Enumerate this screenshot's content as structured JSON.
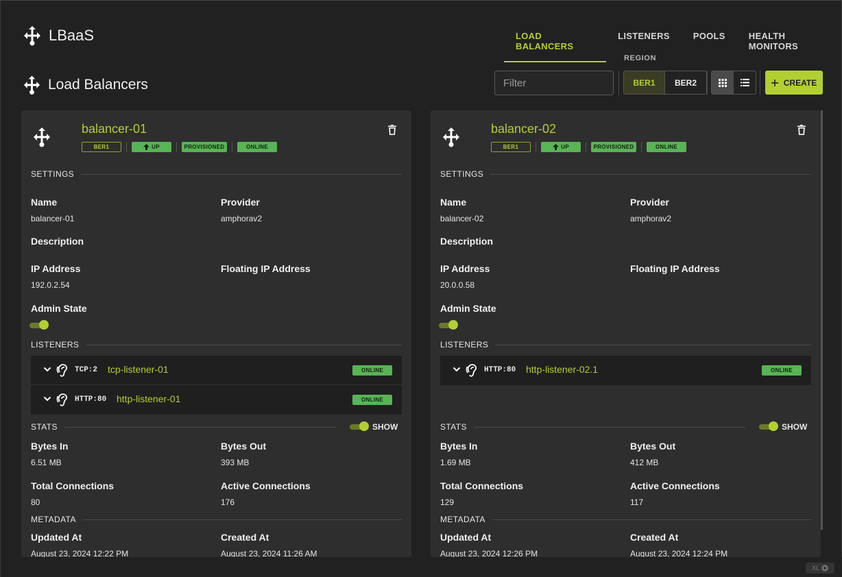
{
  "app": {
    "title": "LBaaS"
  },
  "nav": {
    "tabs": [
      {
        "label": "LOAD BALANCERS",
        "active": true
      },
      {
        "label": "LISTENERS",
        "active": false
      },
      {
        "label": "POOLS",
        "active": false
      },
      {
        "label": "HEALTH MONITORS",
        "active": false
      }
    ]
  },
  "page": {
    "title": "Load Balancers"
  },
  "toolbar": {
    "filter_placeholder": "Filter",
    "region_label": "REGION",
    "regions": [
      "BER1",
      "BER2"
    ],
    "selected_region": "BER1",
    "view_modes": [
      "grid",
      "list"
    ],
    "selected_view": "grid",
    "create_label": "CREATE"
  },
  "section_titles": {
    "settings": "SETTINGS",
    "listeners": "LISTENERS",
    "stats": "STATS",
    "metadata": "METADATA"
  },
  "field_labels": {
    "name": "Name",
    "provider": "Provider",
    "description": "Description",
    "ip_address": "IP Address",
    "floating_ip": "Floating IP Address",
    "admin_state": "Admin State",
    "bytes_in": "Bytes In",
    "bytes_out": "Bytes Out",
    "total_connections": "Total Connections",
    "active_connections": "Active Connections",
    "updated_at": "Updated At",
    "created_at": "Created At",
    "show": "SHOW"
  },
  "balancers": [
    {
      "name": "balancer-01",
      "badges": {
        "region": "BER1",
        "status": "UP",
        "provisioning": "PROVISIONED",
        "operating": "ONLINE"
      },
      "settings": {
        "name": "balancer-01",
        "provider": "amphorav2",
        "description": "",
        "ip_address": "192.0.2.54",
        "floating_ip": "",
        "admin_state": true
      },
      "listeners": [
        {
          "protocol": "TCP:2",
          "name": "tcp-listener-01",
          "status": "ONLINE"
        },
        {
          "protocol": "HTTP:80",
          "name": "http-listener-01",
          "status": "ONLINE"
        }
      ],
      "stats": {
        "show": true,
        "bytes_in": "6.51 MB",
        "bytes_out": "393 MB",
        "total_connections": "80",
        "active_connections": "176"
      },
      "metadata": {
        "updated_at": "August 23, 2024 12:22 PM",
        "created_at": "August 23, 2024 11:26 AM"
      }
    },
    {
      "name": "balancer-02",
      "badges": {
        "region": "BER1",
        "status": "UP",
        "provisioning": "PROVISIONED",
        "operating": "ONLINE"
      },
      "settings": {
        "name": "balancer-02",
        "provider": "amphorav2",
        "description": "",
        "ip_address": "20.0.0.58",
        "floating_ip": "",
        "admin_state": true
      },
      "listeners": [
        {
          "protocol": "HTTP:80",
          "name": "http-listener-02.1",
          "status": "ONLINE"
        }
      ],
      "stats": {
        "show": true,
        "bytes_in": "1.69 MB",
        "bytes_out": "412 MB",
        "total_connections": "129",
        "active_connections": "117"
      },
      "metadata": {
        "updated_at": "August 23, 2024 12:26 PM",
        "created_at": "August 23, 2024 12:24 PM"
      }
    }
  ],
  "corner_badge": "XL",
  "colors": {
    "accent": "#b2cf32",
    "online": "#58b455",
    "background": "#212121",
    "card": "#2e2e2e"
  }
}
